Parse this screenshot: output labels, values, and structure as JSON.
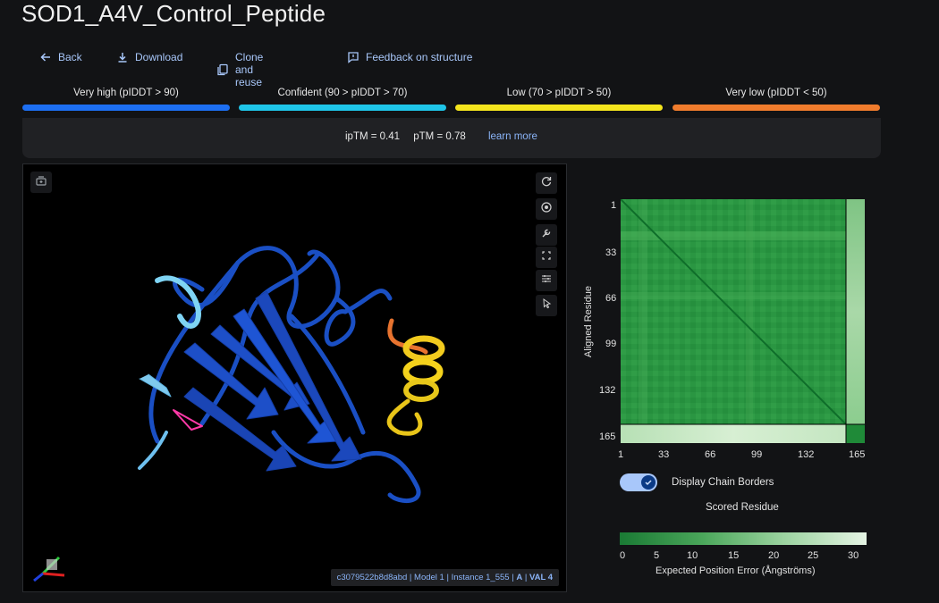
{
  "page": {
    "title": "SOD1_A4V_Control_Peptide"
  },
  "actions": {
    "back": "Back",
    "download": "Download",
    "clone": "Clone and reuse",
    "feedback": "Feedback on structure"
  },
  "plddt_legend": [
    {
      "label": "Very high (pIDDT > 90)",
      "color": "#1d6ff2"
    },
    {
      "label": "Confident (90 > pIDDT > 70)",
      "color": "#1fc5e8"
    },
    {
      "label": "Low (70 > pIDDT > 50)",
      "color": "#f4e51d"
    },
    {
      "label": "Very low (pIDDT < 50)",
      "color": "#f07c2d"
    }
  ],
  "scores": {
    "iptm": "ipTM = 0.41",
    "ptm": "pTM = 0.78",
    "learn_more": "learn more"
  },
  "viewer": {
    "info_id": "c3079522b8d8abd",
    "info_model": "Model 1",
    "info_instance": "Instance 1_555",
    "info_chain": "A",
    "info_residue": "VAL 4"
  },
  "pae": {
    "y_title": "Aligned Residue",
    "x_title": "Scored Residue",
    "ticks": [
      "1",
      "33",
      "66",
      "99",
      "132",
      "165"
    ],
    "toggle_label": "Display Chain Borders",
    "toggle_on": true,
    "colorbar_ticks": [
      "0",
      "5",
      "10",
      "15",
      "20",
      "25",
      "30"
    ],
    "colorbar_title": "Expected Position Error (Ångströms)",
    "colors": {
      "low": "#1a7a34",
      "high": "#e5f4e4"
    }
  }
}
